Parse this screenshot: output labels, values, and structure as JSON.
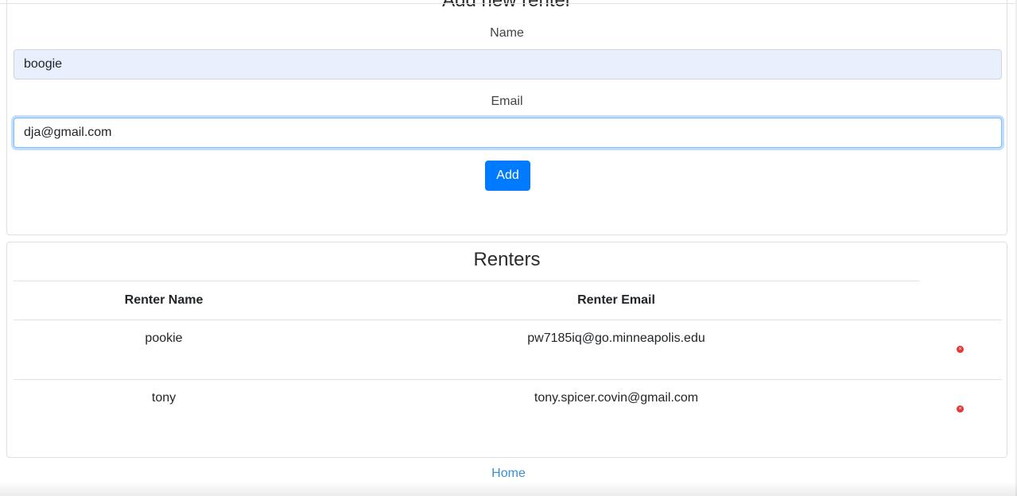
{
  "add_form": {
    "title": "Add new renter",
    "name_label": "Name",
    "name_value": "boogie",
    "email_label": "Email",
    "email_value": "dja@gmail.com",
    "add_label": "Add"
  },
  "renters": {
    "title": "Renters",
    "columns": [
      "Renter Name",
      "Renter Email"
    ],
    "rows": [
      {
        "name": "pookie",
        "email": "pw7185iq@go.minneapolis.edu",
        "delete_icon": "×"
      },
      {
        "name": "tony",
        "email": "tony.spicer.covin@gmail.com",
        "delete_icon": "×"
      }
    ]
  },
  "footer": {
    "home_label": "Home"
  },
  "colors": {
    "primary": "#007bff",
    "link": "#3a8fd6",
    "delete": "#e53935",
    "autofill": "#e8f0fe"
  }
}
